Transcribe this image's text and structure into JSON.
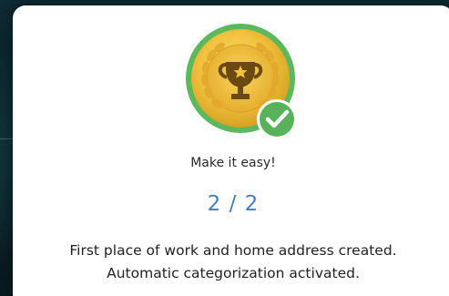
{
  "achievement": {
    "title": "Make it easy!",
    "progress_text": "2 / 2",
    "description_lines": [
      "First place of work and home address created.",
      "Automatic categorization activated."
    ],
    "badge_icon": "trophy-star-icon",
    "status_icon": "checkmark-icon"
  },
  "colors": {
    "medal_gold": "#e6b73a",
    "medal_ring": "#5cb85c",
    "check_badge": "#58b25b",
    "progress_text": "#3f7fbd"
  }
}
